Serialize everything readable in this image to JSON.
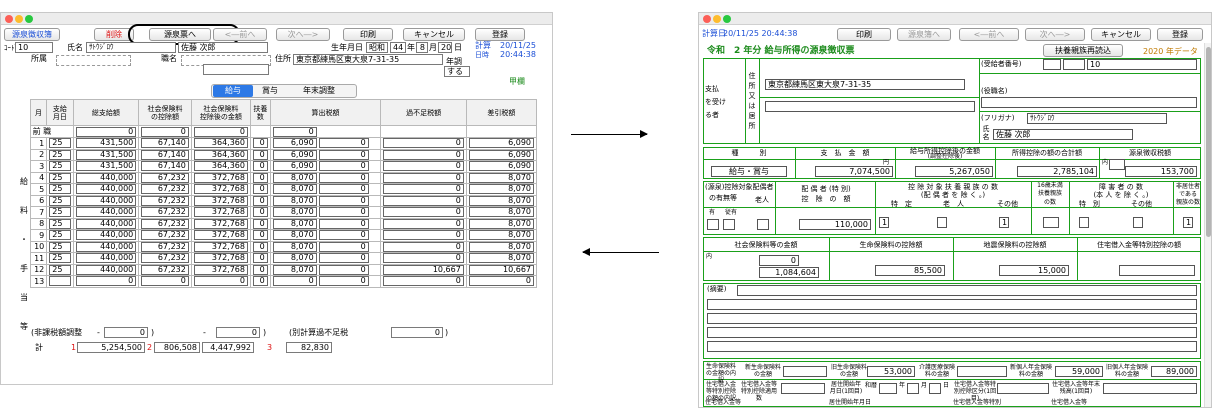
{
  "left": {
    "toolbar": {
      "source_label": "源泉徴収簿",
      "delete": "削除",
      "to_source": "源泉票へ",
      "prev": "<―前へ",
      "next": "次へ―>",
      "print": "印刷",
      "cancel": "キャンセル",
      "register": "登録"
    },
    "header": {
      "code_label": "ｺｰﾄﾞ",
      "code": "10",
      "name_label": "氏名",
      "name_kana": "ｻﾄｳｼﾞﾛｳ",
      "name": "佐藤 次郎",
      "birth_label": "生年月日",
      "era": "昭和",
      "year": "44",
      "year_unit": "年",
      "month": "8",
      "month_unit": "月",
      "day": "20",
      "day_unit": "日",
      "calc_label": "計算",
      "calc_date": "20/11/25",
      "time_label": "日時",
      "calc_time": "20:44:38",
      "dept_label": "所属",
      "post_label": "職名",
      "address_label": "住所",
      "address": "東京都練馬区東大泉7-31-35",
      "nencho_label": "年調",
      "nencho_value": "する",
      "column_label": "甲欄"
    },
    "tabs": [
      "給与",
      "賞与",
      "年末調整"
    ],
    "table": {
      "headers": [
        "月",
        "支給\n月日",
        "総支給額",
        "社会保険料\nの控除額",
        "社会保険料\n控除後の金額",
        "扶養\n数",
        "算出税額",
        "過不足税額",
        "差引税額"
      ],
      "side_label": [
        "給",
        "料",
        "・",
        "手",
        "当",
        "等"
      ],
      "prev_row": {
        "label": "前 職",
        "total": "0",
        "social": "0",
        "after": "0",
        "tax": "0"
      },
      "rows": [
        {
          "m": "1",
          "d": "25",
          "total": "431,500",
          "social": "67,140",
          "after": "364,360",
          "dep": "0",
          "tax": "6,090",
          "adj": "0",
          "diff": "0",
          "net": "6,090"
        },
        {
          "m": "2",
          "d": "25",
          "total": "431,500",
          "social": "67,140",
          "after": "364,360",
          "dep": "0",
          "tax": "6,090",
          "adj": "0",
          "diff": "0",
          "net": "6,090"
        },
        {
          "m": "3",
          "d": "25",
          "total": "431,500",
          "social": "67,140",
          "after": "364,360",
          "dep": "0",
          "tax": "6,090",
          "adj": "0",
          "diff": "0",
          "net": "6,090"
        },
        {
          "m": "4",
          "d": "25",
          "total": "440,000",
          "social": "67,232",
          "after": "372,768",
          "dep": "0",
          "tax": "8,070",
          "adj": "0",
          "diff": "0",
          "net": "8,070"
        },
        {
          "m": "5",
          "d": "25",
          "total": "440,000",
          "social": "67,232",
          "after": "372,768",
          "dep": "0",
          "tax": "8,070",
          "adj": "0",
          "diff": "0",
          "net": "8,070"
        },
        {
          "m": "6",
          "d": "25",
          "total": "440,000",
          "social": "67,232",
          "after": "372,768",
          "dep": "0",
          "tax": "8,070",
          "adj": "0",
          "diff": "0",
          "net": "8,070"
        },
        {
          "m": "7",
          "d": "25",
          "total": "440,000",
          "social": "67,232",
          "after": "372,768",
          "dep": "0",
          "tax": "8,070",
          "adj": "0",
          "diff": "0",
          "net": "8,070"
        },
        {
          "m": "8",
          "d": "25",
          "total": "440,000",
          "social": "67,232",
          "after": "372,768",
          "dep": "0",
          "tax": "8,070",
          "adj": "0",
          "diff": "0",
          "net": "8,070"
        },
        {
          "m": "9",
          "d": "25",
          "total": "440,000",
          "social": "67,232",
          "after": "372,768",
          "dep": "0",
          "tax": "8,070",
          "adj": "0",
          "diff": "0",
          "net": "8,070"
        },
        {
          "m": "10",
          "d": "25",
          "total": "440,000",
          "social": "67,232",
          "after": "372,768",
          "dep": "0",
          "tax": "8,070",
          "adj": "0",
          "diff": "0",
          "net": "8,070"
        },
        {
          "m": "11",
          "d": "25",
          "total": "440,000",
          "social": "67,232",
          "after": "372,768",
          "dep": "0",
          "tax": "8,070",
          "adj": "0",
          "diff": "0",
          "net": "8,070"
        },
        {
          "m": "12",
          "d": "25",
          "total": "440,000",
          "social": "67,232",
          "after": "372,768",
          "dep": "0",
          "tax": "8,070",
          "adj": "0",
          "diff": "10,667",
          "net": "10,667"
        },
        {
          "m": "13",
          "d": "",
          "total": "0",
          "social": "0",
          "after": "0",
          "dep": "0",
          "tax": "0",
          "adj": "0",
          "diff": "0",
          "net": "0"
        }
      ],
      "nontax_label": "(非課税額調整",
      "nontax_minus": "-",
      "nontax_val": "0",
      "nontax_paren": ")",
      "nontax_minus2": "-",
      "nontax_val2": "0",
      "nontax_paren2": ")",
      "separate_label": "(別計算過不足税",
      "separate_val": "0",
      "separate_paren": ")",
      "total_label": "計",
      "t1": "1",
      "total": "5,254,500",
      "t2": "2",
      "social_total": "806,508",
      "after_total": "4,447,992",
      "t3": "3",
      "tax_total": "82,830"
    }
  },
  "right": {
    "toolbar": {
      "calc_label": "計算日",
      "calc_datetime": "20/11/25 20:44:38",
      "print": "印刷",
      "to_ledger": "源泉簿へ",
      "prev": "<―前へ",
      "next": "次へ―>",
      "cancel": "キャンセル",
      "register": "登録"
    },
    "title": "令和　2 年分 給与所得の源泉徴収票",
    "reread": "扶養親族再読込",
    "year_data": "2020 年データ",
    "payee": {
      "side1": "支払",
      "side2": "を受け",
      "side3": "る者",
      "addr_side": "住所又は居所",
      "address": "東京都練馬区東大泉7-31-35",
      "receiver_no_label": "(受給者番号)",
      "receiver_no": "10",
      "post_label": "(役職名)",
      "kana_label": "(フリガナ)",
      "kana": "ｻﾄｳｼﾞﾛｳ",
      "name_side": "氏名",
      "name": "佐藤 次郎"
    },
    "amounts": {
      "type_h": "種　　　別",
      "pay_h": "支　払　金　額",
      "after_h": "給与所得控除後の金額",
      "after_sub": "(調整控除後)",
      "deduct_h": "所得控除の額の合計額",
      "tax_h": "源泉徴収税額",
      "type": "給与・賞与",
      "yen": "円",
      "uchi": "内",
      "pay": "7,074,500",
      "after": "5,267,050",
      "deduct": "2,785,104",
      "tax": "153,700"
    },
    "spouse": {
      "h1": "(源泉)控除対象配偶者",
      "h2": "の有無等",
      "h3": "老人",
      "sp_h": "配 偶 者 (特 別)",
      "sp_h2": "控　除　の　額",
      "dep_h": "控 除 対 象 扶 養 親 族 の 数",
      "dep_h2": "(配 偶 者 を 除 く 。)",
      "under16": "16歳未満",
      "under16b": "扶養親族",
      "under16c": "の数",
      "dis_h": "障 害 者 の 数",
      "dis_h2": "(本 人 を 除 く 。)",
      "nonres": "非居住者",
      "nonres2": "である",
      "nonres3": "親族の数",
      "tokutei": "特　定",
      "rojin": "老　人",
      "sonota": "その他",
      "tokubetsu": "特　別",
      "sonota2": "その他",
      "yu": "有",
      "jusha": "従有",
      "nin": "人",
      "uchi": "内",
      "jujin": "従人",
      "sp_amount": "110,000",
      "tokutei_v": "1",
      "sonota_v": "1",
      "nonres_v": "1"
    },
    "ins": {
      "h1": "社会保険料等の金額",
      "h2": "生命保険料の控除額",
      "h3": "地震保険料の控除額",
      "h4": "住宅借入金等特別控除の額",
      "uchi": "内",
      "yen": "円",
      "v_uchi": "0",
      "v1": "1,084,604",
      "v2": "85,500",
      "v3": "15,000"
    },
    "memo_label": "(摘要)",
    "bottom": {
      "l1": "生命保険料の金額の内訳",
      "b1": "新生命保険料の金額",
      "b2": "旧生命保険料の金額",
      "b3": "介護医療保険料の金額",
      "b4": "新個人年金保険料の金額",
      "b5": "旧個人年金保険料の金額",
      "v3": "53,000",
      "v4": "59,000",
      "v5": "89,000",
      "l2": "住宅借入金等特別控除の額の内訳",
      "c1": "住宅借入金等特別控除適用数",
      "c2": "居住開始年月日(1回目)",
      "wa": "和暦",
      "nen": "年",
      "tsuki": "月",
      "hi": "日",
      "c3": "住宅借入金等特別控除区分(1回目)",
      "c4": "住宅借入金等年末残高(1回目)",
      "c5": "住宅借入金等",
      "c6": "居住開始年月日",
      "c7": "住宅借入金等特別",
      "c8": "住宅借入金等"
    }
  }
}
